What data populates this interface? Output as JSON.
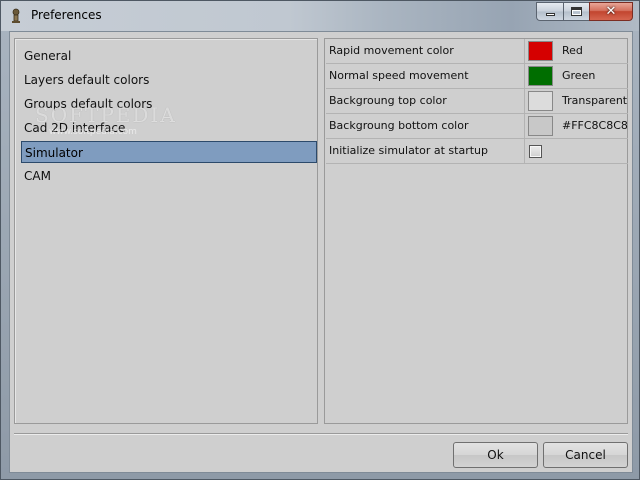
{
  "window": {
    "title": "Preferences",
    "minimize_icon": "minimize-icon",
    "maximize_icon": "maximize-icon",
    "close_glyph": "✕"
  },
  "nav": {
    "items": [
      {
        "label": "General",
        "selected": false
      },
      {
        "label": "Layers default colors",
        "selected": false
      },
      {
        "label": "Groups default colors",
        "selected": false
      },
      {
        "label": "Cad 2D interface",
        "selected": false
      },
      {
        "label": "Simulator",
        "selected": true
      },
      {
        "label": "CAM",
        "selected": false
      }
    ]
  },
  "properties": [
    {
      "name": "Rapid movement color",
      "type": "color",
      "color": "#D50000",
      "value": "Red"
    },
    {
      "name": "Normal speed movement",
      "type": "color",
      "color": "#006E00",
      "value": "Green"
    },
    {
      "name": "Backgroung top color",
      "type": "color",
      "color": "#DCDCDC",
      "value": "Transparent"
    },
    {
      "name": "Backgroung bottom color",
      "type": "color",
      "color": "#C8C8C8",
      "value": "#FFC8C8C8"
    },
    {
      "name": "Initialize simulator at startup",
      "type": "checkbox",
      "checked": false
    }
  ],
  "buttons": {
    "ok": "Ok",
    "cancel": "Cancel"
  },
  "watermark": {
    "text": "SOFTPEDIA",
    "sub": "www.softpedia.com"
  },
  "colors": {
    "selection": "#7F9CBF",
    "selection_border": "#2C4A6B"
  }
}
